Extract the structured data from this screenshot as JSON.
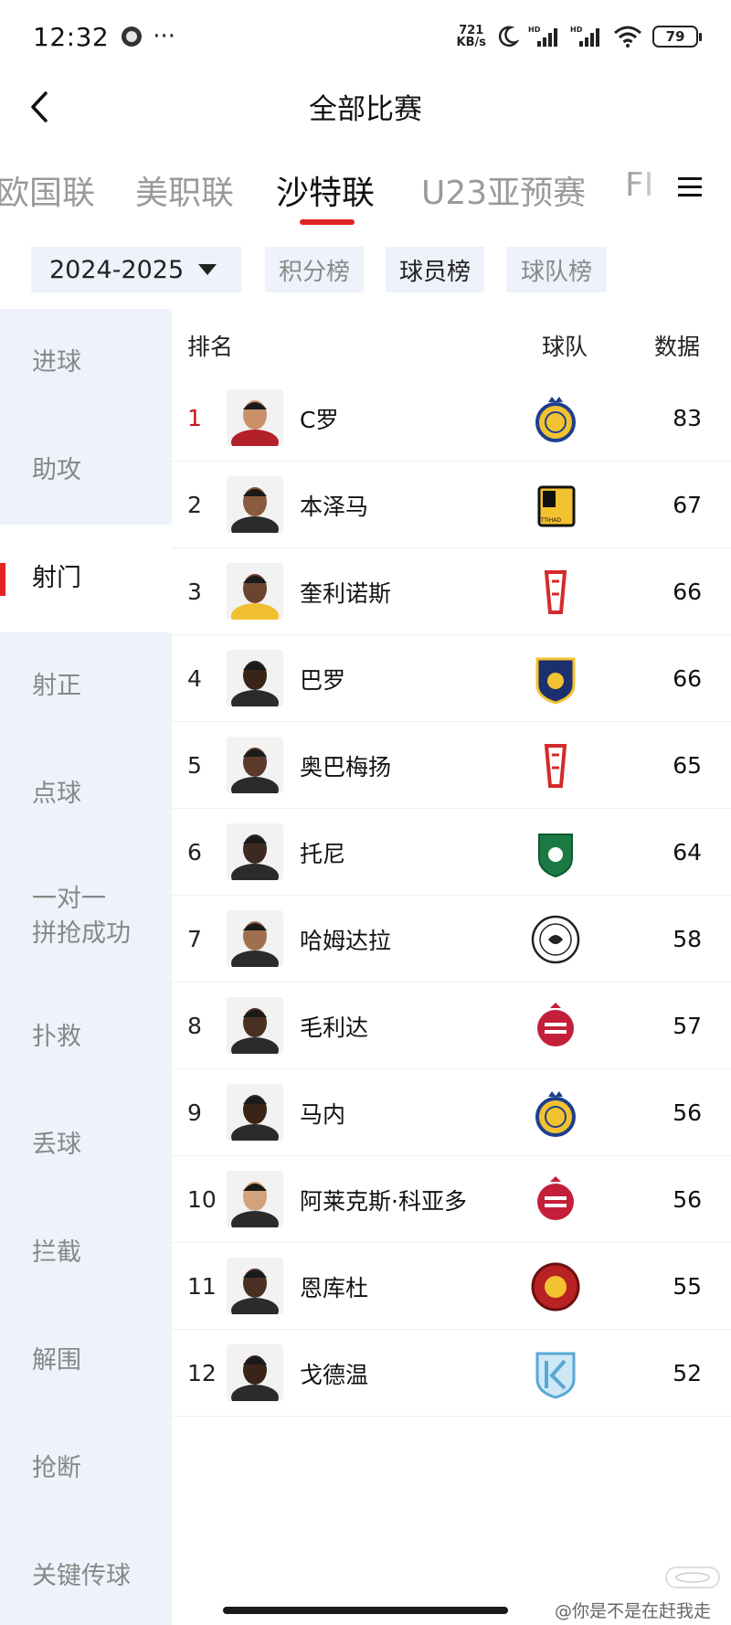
{
  "status_bar": {
    "time": "12:32",
    "more": "···",
    "net_speed_value": "721",
    "net_speed_unit": "KB/s",
    "signal_tag": "HD",
    "battery": "79"
  },
  "header": {
    "title": "全部比赛",
    "back_icon": "chevron-left-icon"
  },
  "league_tabs": [
    {
      "label": "欧国联",
      "active": false
    },
    {
      "label": "美职联",
      "active": false
    },
    {
      "label": "沙特联",
      "active": true
    },
    {
      "label": "U23亚预赛",
      "active": false
    },
    {
      "label": "FI",
      "active": false
    }
  ],
  "filters": {
    "season": "2024-2025",
    "buttons": [
      {
        "label": "积分榜",
        "active": false
      },
      {
        "label": "球员榜",
        "active": true
      },
      {
        "label": "球队榜",
        "active": false
      }
    ]
  },
  "sidebar": {
    "items": [
      {
        "label": "进球",
        "active": false
      },
      {
        "label": "助攻",
        "active": false
      },
      {
        "label": "射门",
        "active": true
      },
      {
        "label": "射正",
        "active": false
      },
      {
        "label": "点球",
        "active": false
      },
      {
        "label": "一对一\n拼抢成功",
        "active": false
      },
      {
        "label": "扑救",
        "active": false
      },
      {
        "label": "丢球",
        "active": false
      },
      {
        "label": "拦截",
        "active": false
      },
      {
        "label": "解围",
        "active": false
      },
      {
        "label": "抢断",
        "active": false
      },
      {
        "label": "关键传球",
        "active": false
      }
    ]
  },
  "table": {
    "columns": {
      "rank": "排名",
      "team": "球队",
      "data": "数据"
    },
    "rows": [
      {
        "rank": "1",
        "name": "C罗",
        "value": "83",
        "team_badge": "al-nassr-badge"
      },
      {
        "rank": "2",
        "name": "本泽马",
        "value": "67",
        "team_badge": "al-ittihad-badge"
      },
      {
        "rank": "3",
        "name": "奎利诺斯",
        "value": "66",
        "team_badge": "al-qadsiah-badge"
      },
      {
        "rank": "4",
        "name": "巴罗",
        "value": "66",
        "team_badge": "al-taawoun-badge"
      },
      {
        "rank": "5",
        "name": "奥巴梅扬",
        "value": "65",
        "team_badge": "al-qadsiah-badge"
      },
      {
        "rank": "6",
        "name": "托尼",
        "value": "64",
        "team_badge": "al-ahli-badge"
      },
      {
        "rank": "7",
        "name": "哈姆达拉",
        "value": "58",
        "team_badge": "al-shabab-badge"
      },
      {
        "rank": "8",
        "name": "毛利达",
        "value": "57",
        "team_badge": "al-ettifaq-badge"
      },
      {
        "rank": "9",
        "name": "马内",
        "value": "56",
        "team_badge": "al-nassr-badge"
      },
      {
        "rank": "10",
        "name": "阿莱克斯·科亚多",
        "value": "56",
        "team_badge": "al-ettifaq-badge"
      },
      {
        "rank": "11",
        "name": "恩库杜",
        "value": "55",
        "team_badge": "damac-badge"
      },
      {
        "rank": "12",
        "name": "戈德温",
        "value": "52",
        "team_badge": "al-khaleej-badge"
      }
    ]
  },
  "watermark": "@你是不是在赶我走",
  "colors": {
    "accent": "#e12424",
    "sidebar_bg": "#eef2fa",
    "muted_text": "#9a9a9a"
  }
}
